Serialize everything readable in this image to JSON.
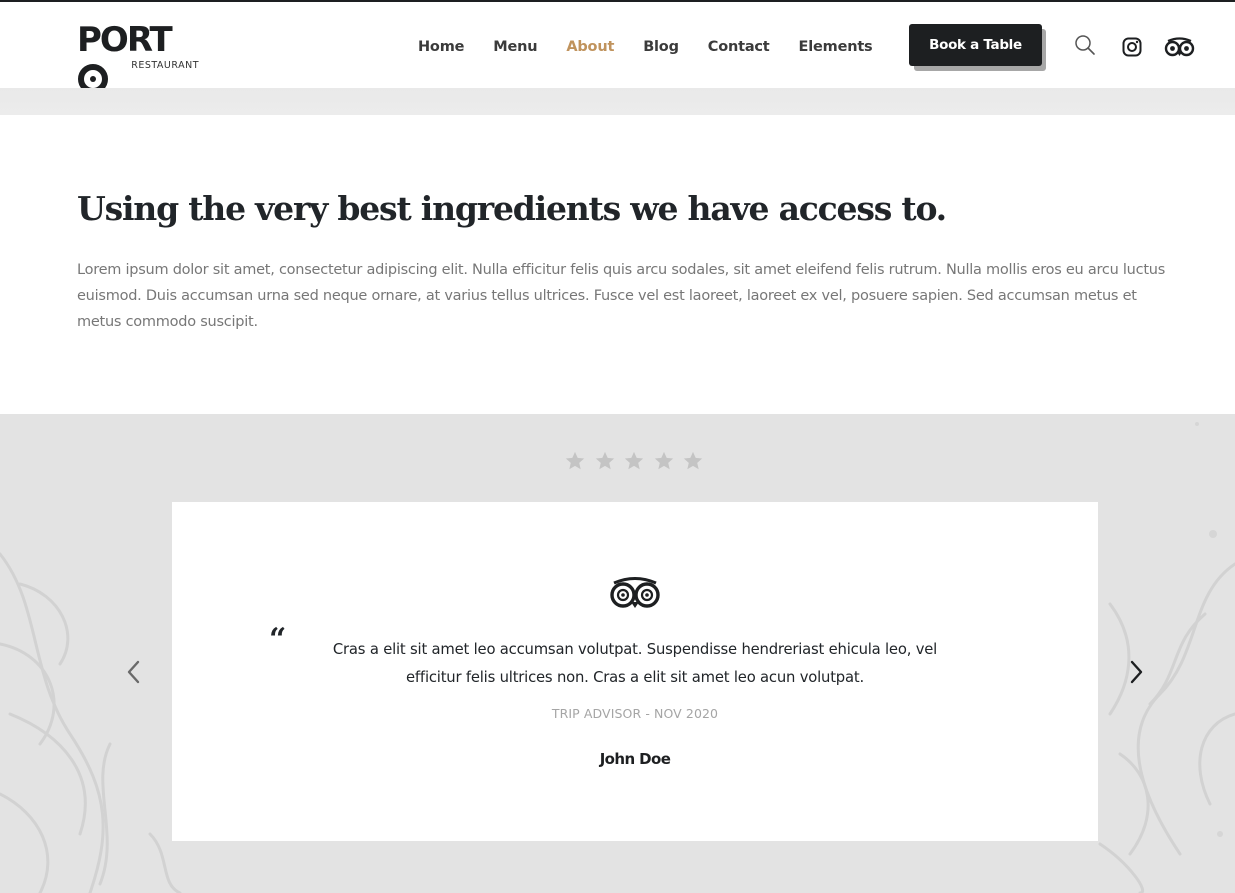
{
  "brand": {
    "name": "PORTO",
    "tagline": "RESTAURANT"
  },
  "nav": {
    "items": [
      {
        "label": "Home",
        "active": false
      },
      {
        "label": "Menu",
        "active": false
      },
      {
        "label": "About",
        "active": true
      },
      {
        "label": "Blog",
        "active": false
      },
      {
        "label": "Contact",
        "active": false
      },
      {
        "label": "Elements",
        "active": false
      }
    ],
    "cta_label": "Book a Table",
    "icons": [
      "search-icon",
      "instagram-icon",
      "tripadvisor-icon"
    ]
  },
  "intro": {
    "title": "Using the very best ingredients we have access to.",
    "body": "Lorem ipsum dolor sit amet, consectetur adipiscing elit. Nulla efficitur felis quis arcu sodales, sit amet eleifend felis rutrum. Nulla mollis eros eu arcu luctus euismod. Duis accumsan urna sed neque ornare, at varius tellus ultrices. Fusce vel est laoreet, laoreet ex vel, posuere sapien. Sed accumsan metus et metus commodo suscipit."
  },
  "testimonial": {
    "rating": 5,
    "quote_mark": "“",
    "quote": "Cras a elit sit amet leo accumsan volutpat. Suspendisse hendreriast ehicula leo, vel efficitur felis ultrices non. Cras a elit sit amet leo acun volutpat.",
    "source": "TRIP ADVISOR - NOV 2020",
    "author": "John Doe",
    "icon": "tripadvisor-owl-icon"
  },
  "colors": {
    "accent": "#c0935d",
    "dark": "#1d1f21",
    "section_bg": "#e3e3e3",
    "muted_text": "#777777",
    "star": "#c4c4c4"
  }
}
